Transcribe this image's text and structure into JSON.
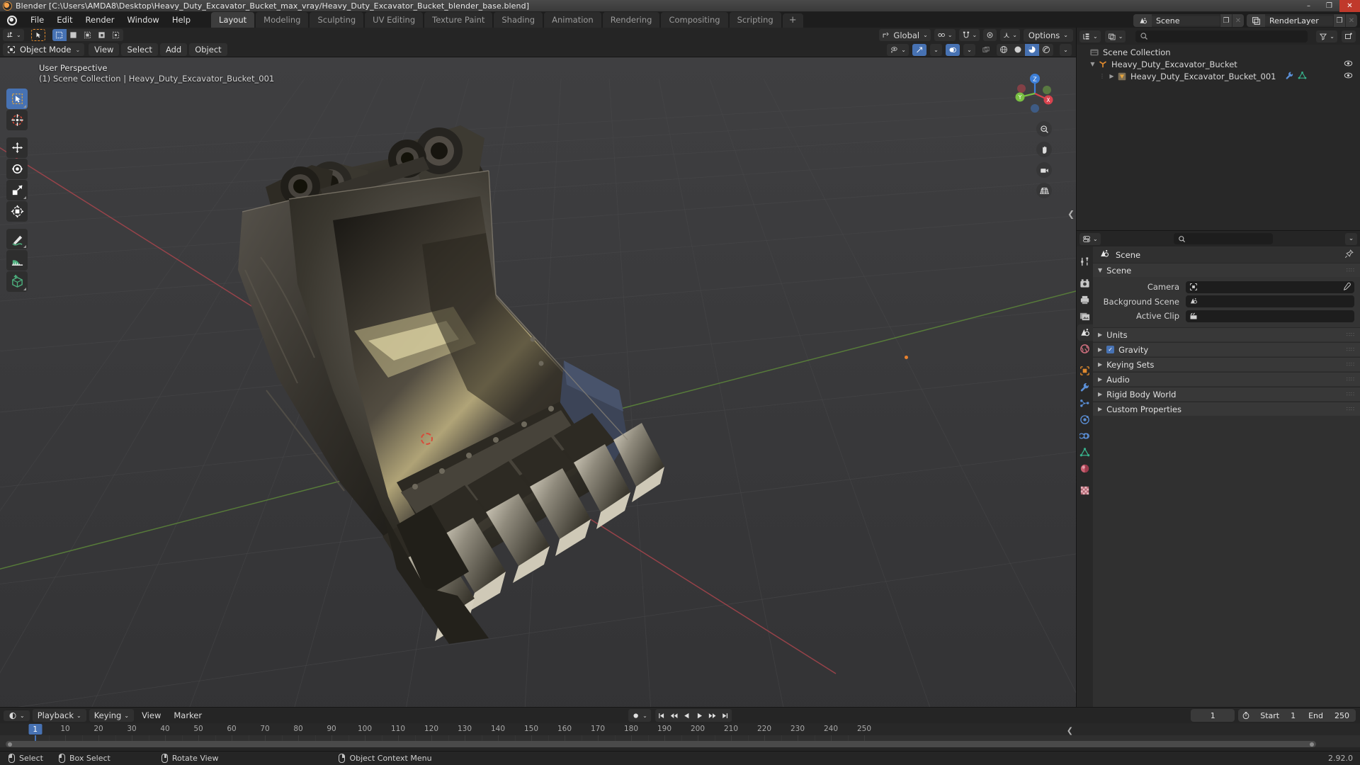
{
  "window": {
    "title": "Blender [C:\\Users\\AMDA8\\Desktop\\Heavy_Duty_Excavator_Bucket_max_vray/Heavy_Duty_Excavator_Bucket_blender_base.blend]",
    "minimize": "–",
    "maximize": "❐",
    "close": "✕"
  },
  "topbar": {
    "menus": [
      "File",
      "Edit",
      "Render",
      "Window",
      "Help"
    ],
    "workspaces": [
      {
        "label": "Layout",
        "active": true
      },
      {
        "label": "Modeling",
        "active": false
      },
      {
        "label": "Sculpting",
        "active": false
      },
      {
        "label": "UV Editing",
        "active": false
      },
      {
        "label": "Texture Paint",
        "active": false
      },
      {
        "label": "Shading",
        "active": false
      },
      {
        "label": "Animation",
        "active": false
      },
      {
        "label": "Rendering",
        "active": false
      },
      {
        "label": "Compositing",
        "active": false
      },
      {
        "label": "Scripting",
        "active": false
      }
    ],
    "add_workspace": "+",
    "scene_name": "Scene",
    "viewlayer_name": "RenderLayer",
    "copy_glyph": "❐",
    "close_glyph": "✕"
  },
  "viewport_header": {
    "mode": "Object Mode",
    "menus": [
      "View",
      "Select",
      "Add",
      "Object"
    ],
    "transform_orientation": "Global",
    "options_label": "Options",
    "chevron": "⌄"
  },
  "viewport": {
    "perspective_label": "User Perspective",
    "scene_info": "(1) Scene Collection | Heavy_Duty_Excavator_Bucket_001",
    "gizmo_axes": {
      "z": "Z",
      "y": "Y",
      "x": "X"
    },
    "nav_icons": [
      "zoom-icon",
      "hand-icon",
      "camera-icon",
      "grid-icon"
    ]
  },
  "toolbar": {
    "tools": [
      {
        "name": "tweak-select-tool",
        "active": true
      },
      {
        "name": "cursor-tool",
        "active": false
      },
      {
        "name": "move-tool",
        "active": false
      },
      {
        "name": "rotate-tool",
        "active": false
      },
      {
        "name": "scale-tool",
        "active": false
      },
      {
        "name": "transform-tool",
        "active": false
      },
      {
        "name": "annotate-tool",
        "active": false
      },
      {
        "name": "measure-tool",
        "active": false
      },
      {
        "name": "add-cube-tool",
        "active": false
      }
    ]
  },
  "outliner": {
    "search_placeholder": "",
    "rows": [
      {
        "label": "Scene Collection",
        "icon": "collection-icon",
        "indent": 0,
        "expander": "",
        "eye": false
      },
      {
        "label": "Heavy_Duty_Excavator_Bucket",
        "icon": "empty-axis-icon",
        "indent": 1,
        "expander": "▼",
        "eye": true
      },
      {
        "label": "Heavy_Duty_Excavator_Bucket_001",
        "icon": "mesh-data-icon",
        "indent": 2,
        "expander": "▶",
        "eye": true
      }
    ]
  },
  "properties": {
    "title": "Scene",
    "panel_open": {
      "label": "Scene",
      "fields": [
        {
          "label": "Camera",
          "value": "",
          "icon": "camera-data-icon",
          "eyedropper": true
        },
        {
          "label": "Background Scene",
          "value": "",
          "icon": "scene-icon",
          "eyedropper": false
        },
        {
          "label": "Active Clip",
          "value": "",
          "icon": "clip-icon",
          "eyedropper": false
        }
      ]
    },
    "panels_closed": [
      {
        "label": "Units",
        "checkbox": false
      },
      {
        "label": "Gravity",
        "checkbox": true
      },
      {
        "label": "Keying Sets",
        "checkbox": false
      },
      {
        "label": "Audio",
        "checkbox": false
      },
      {
        "label": "Rigid Body World",
        "checkbox": false
      },
      {
        "label": "Custom Properties",
        "checkbox": false
      }
    ],
    "tabs": [
      {
        "name": "tool-tab",
        "active": false
      },
      {
        "name": "render-tab",
        "active": false
      },
      {
        "name": "output-tab",
        "active": false
      },
      {
        "name": "view-layer-tab",
        "active": false
      },
      {
        "name": "scene-tab",
        "active": true
      },
      {
        "name": "world-tab",
        "active": false
      },
      {
        "name": "object-tab",
        "active": false
      },
      {
        "name": "modifier-tab",
        "active": false
      },
      {
        "name": "particles-tab",
        "active": false
      },
      {
        "name": "physics-tab",
        "active": false
      },
      {
        "name": "constraints-tab",
        "active": false
      },
      {
        "name": "object-data-tab",
        "active": false
      },
      {
        "name": "material-tab",
        "active": false
      },
      {
        "name": "texture-tab",
        "active": false
      }
    ]
  },
  "timeline": {
    "menus": [
      "Playback",
      "Keying",
      "View",
      "Marker"
    ],
    "current_frame": "1",
    "start_label": "Start",
    "start_value": "1",
    "end_label": "End",
    "end_value": "250",
    "ticks": [
      10,
      20,
      30,
      40,
      50,
      60,
      70,
      80,
      90,
      100,
      110,
      120,
      130,
      140,
      150,
      160,
      170,
      180,
      190,
      200,
      210,
      220,
      230,
      240,
      250
    ],
    "playhead_frame": "1",
    "transport": [
      "⏮",
      "⏪",
      "◀",
      "▶",
      "⏩",
      "⏭"
    ]
  },
  "status": {
    "items": [
      {
        "mouse": "left",
        "label": "Select"
      },
      {
        "mouse": "left-drag",
        "label": "Box Select"
      },
      {
        "mouse": "middle",
        "label": "Rotate View"
      },
      {
        "mouse": "right",
        "label": "Object Context Menu"
      }
    ],
    "version": "2.92.0"
  },
  "colors": {
    "accent": "#4772b3",
    "orange": "#e08a2e",
    "axis_x": "#d8434e",
    "axis_y": "#7ac043",
    "axis_z": "#3d7fd8",
    "header_bg": "#252525",
    "panel_bg": "#303030",
    "viewport_bg": "#3a3a3c"
  }
}
